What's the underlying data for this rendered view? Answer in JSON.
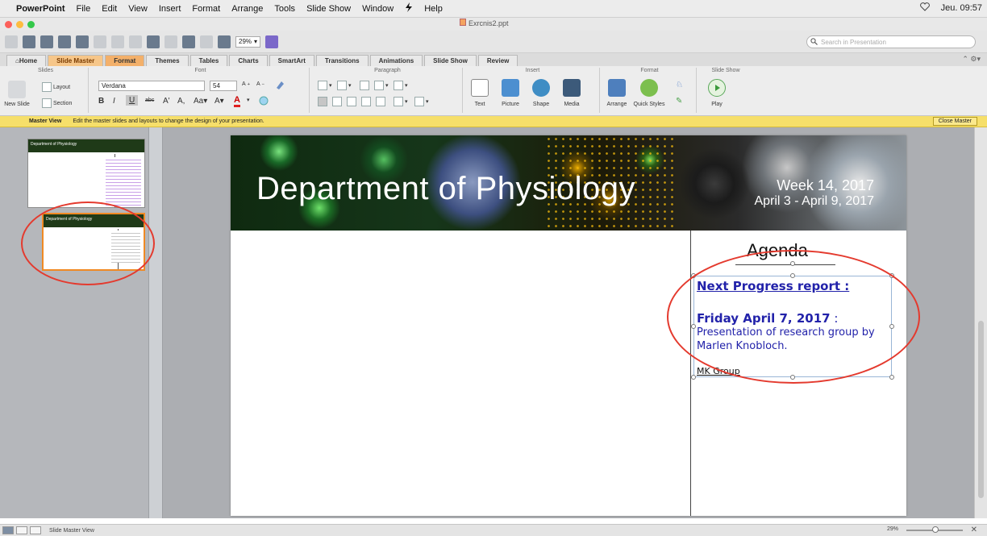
{
  "menubar": {
    "apple": "",
    "app": "PowerPoint",
    "items": [
      "File",
      "Edit",
      "View",
      "Insert",
      "Format",
      "Arrange",
      "Tools",
      "Slide Show",
      "Window",
      "",
      "Help"
    ],
    "clock": "Jeu. 09:57"
  },
  "window": {
    "title": "Exrcnis2.ppt"
  },
  "toolbar": {
    "zoom": "29%",
    "search_placeholder": "Search in Presentation"
  },
  "ribbon_tabs": [
    "Home",
    "Slide Master",
    "Format",
    "Themes",
    "Tables",
    "Charts",
    "SmartArt",
    "Transitions",
    "Animations",
    "Slide Show",
    "Review"
  ],
  "ribbon": {
    "groups": {
      "slides": "Slides",
      "font": "Font",
      "paragraph": "Paragraph",
      "insert": "Insert",
      "format": "Format",
      "slideshow": "Slide Show"
    },
    "new_slide": "New Slide",
    "layout": "Layout",
    "section": "Section",
    "font_name": "Verdana",
    "font_size": "54",
    "text": "Text",
    "picture": "Picture",
    "shape": "Shape",
    "media": "Media",
    "arrange": "Arrange",
    "quick_styles": "Quick Styles",
    "play": "Play"
  },
  "master_bar": {
    "label": "Master View",
    "message": "Edit the master slides and layouts to change the design of your presentation.",
    "close": "Close Master"
  },
  "thumbnails": [
    {
      "title": "Department of Physiology"
    },
    {
      "title": "Department of Physiology"
    }
  ],
  "slide": {
    "banner_title": "Department of Physiology",
    "week": "Week 14, 2017",
    "dates": "April 3 - April 9, 2017",
    "agenda": "Agenda",
    "next_progress": "Next Progress report :",
    "friday": "Friday April 7, 2017",
    "friday_colon": " :",
    "presentation": "Presentation of research group by Marlen Knobloch.",
    "mk_group": "MK Group"
  },
  "status": {
    "view": "Slide Master View",
    "zoom": "29%",
    "close": "✕"
  },
  "colors": {
    "accent_tab": "#f3b06a",
    "master_bar": "#f6df6a",
    "annotation": "#e43a2e",
    "agenda_text": "#2222aa"
  }
}
